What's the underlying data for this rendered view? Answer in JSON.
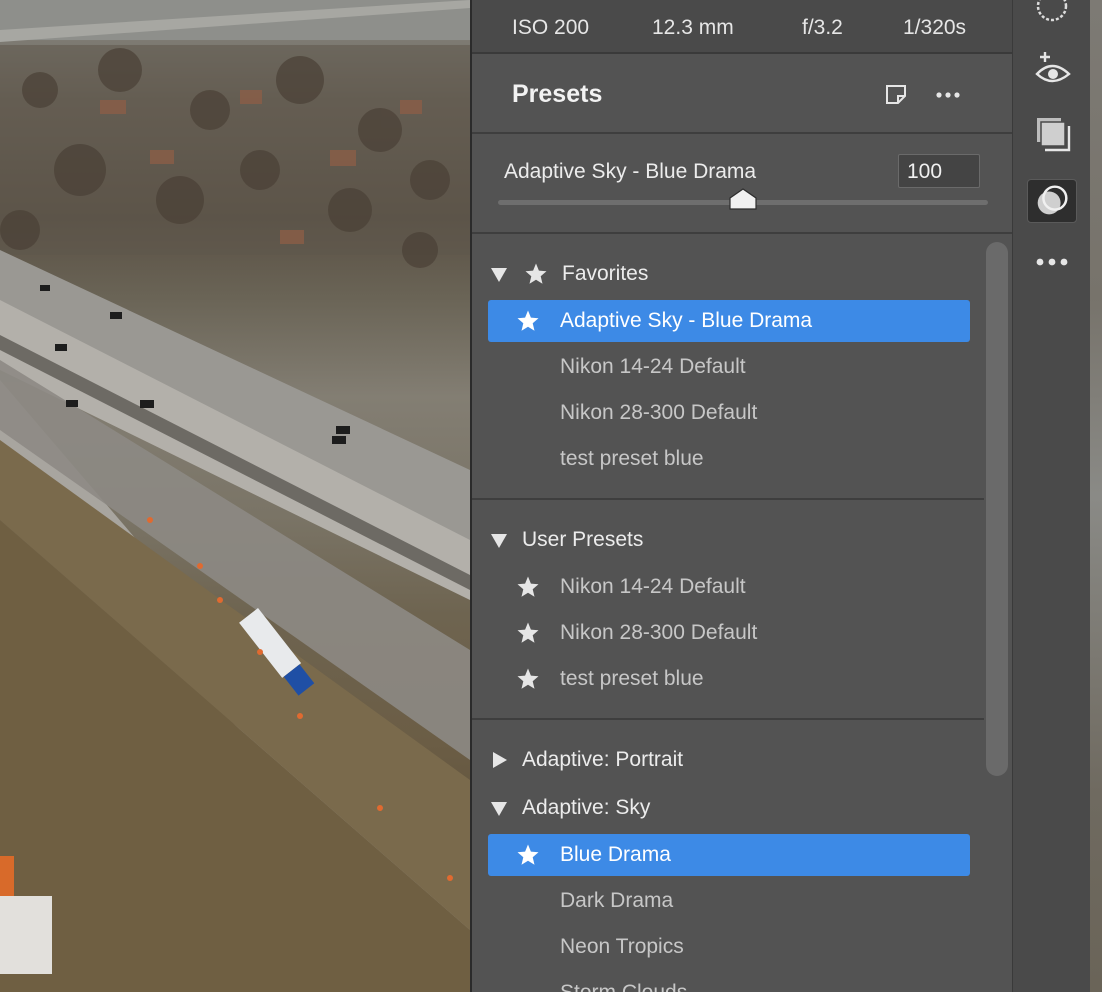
{
  "exif": {
    "iso": "ISO 200",
    "focal_length": "12.3 mm",
    "aperture": "f/3.2",
    "shutter": "1/320s"
  },
  "presets_panel": {
    "title": "Presets",
    "new_preset_icon": "new-preset-icon",
    "more_icon": "ellipsis-icon",
    "applied_preset": "Adaptive Sky - Blue Drama",
    "amount_value": "100",
    "amount_percent": 50
  },
  "groups": {
    "favorites": {
      "label": "Favorites",
      "expanded": true,
      "items": [
        {
          "label": "Adaptive Sky - Blue Drama",
          "selected": true,
          "favorite": true
        },
        {
          "label": "Nikon 14-24 Default",
          "selected": false,
          "favorite": false
        },
        {
          "label": "Nikon 28-300 Default",
          "selected": false,
          "favorite": false
        },
        {
          "label": "test preset blue",
          "selected": false,
          "favorite": false
        }
      ]
    },
    "user_presets": {
      "label": "User Presets",
      "expanded": true,
      "items": [
        {
          "label": "Nikon 14-24 Default",
          "favorite": true
        },
        {
          "label": "Nikon 28-300 Default",
          "favorite": true
        },
        {
          "label": "test preset blue",
          "favorite": true
        }
      ]
    },
    "adaptive_portrait": {
      "label": "Adaptive: Portrait",
      "expanded": false
    },
    "adaptive_sky": {
      "label": "Adaptive: Sky",
      "expanded": true,
      "items": [
        {
          "label": "Blue Drama",
          "selected": true,
          "favorite": true
        },
        {
          "label": "Dark Drama",
          "selected": false,
          "favorite": false
        },
        {
          "label": "Neon Tropics",
          "selected": false,
          "favorite": false
        },
        {
          "label": "Storm Clouds",
          "selected": false,
          "favorite": false
        }
      ]
    }
  },
  "tools": [
    {
      "name": "mask-icon"
    },
    {
      "name": "red-eye-icon"
    },
    {
      "name": "snapshots-icon"
    },
    {
      "name": "presets-icon",
      "active": true
    },
    {
      "name": "more-tools-icon"
    }
  ],
  "colors": {
    "panel": "#535353",
    "selection": "#3d8ae6",
    "header": "#4a4a4a"
  }
}
